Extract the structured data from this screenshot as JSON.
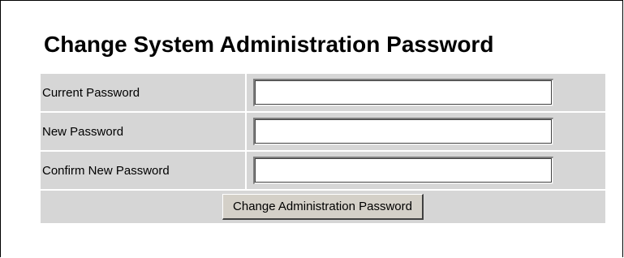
{
  "page": {
    "title": "Change System Administration Password"
  },
  "form": {
    "fields": [
      {
        "label": "Current Password",
        "value": ""
      },
      {
        "label": "New Password",
        "value": ""
      },
      {
        "label": "Confirm New Password",
        "value": ""
      }
    ],
    "submit_label": "Change Administration Password"
  },
  "colors": {
    "row_background": "#d6d6d6",
    "button_background": "#d4d0c8",
    "frame_border": "#000000"
  }
}
